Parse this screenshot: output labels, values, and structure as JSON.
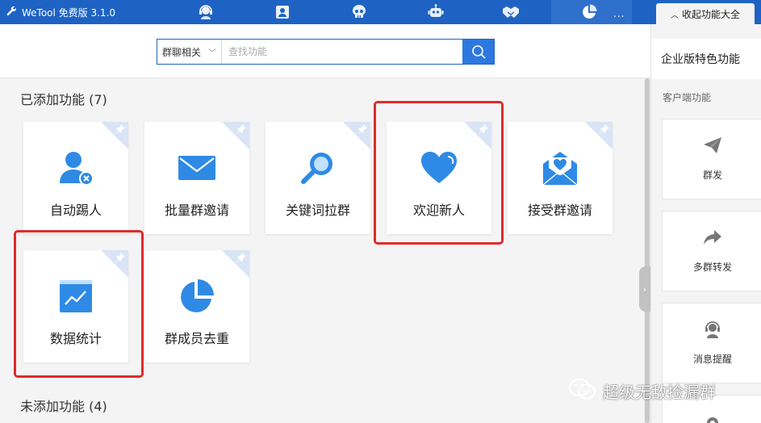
{
  "window": {
    "title": "WeTool 免费版 3.1.0",
    "collapse_label": "收起功能大全",
    "more": "..."
  },
  "nav_icons": [
    "customer-service-icon",
    "contact-card-icon",
    "skull-icon",
    "robot-icon",
    "handshake-icon",
    "pie-chart-icon"
  ],
  "search": {
    "category": "群聊相关",
    "placeholder": "查找功能"
  },
  "added": {
    "title": "已添加功能 (7)",
    "items": [
      {
        "label": "自动踢人",
        "icon": "user-remove-icon"
      },
      {
        "label": "批量群邀请",
        "icon": "envelope-icon"
      },
      {
        "label": "关键词拉群",
        "icon": "magnifier-icon"
      },
      {
        "label": "欢迎新人",
        "icon": "heart-icon"
      },
      {
        "label": "接受群邀请",
        "icon": "envelope-heart-icon"
      },
      {
        "label": "数据统计",
        "icon": "line-chart-icon"
      },
      {
        "label": "群成员去重",
        "icon": "pie-chart-icon"
      }
    ]
  },
  "not_added": {
    "title": "未添加功能 (4)"
  },
  "right_panel": {
    "title": "企业版特色功能",
    "subtitle": "客户端功能",
    "items": [
      {
        "label": "群发",
        "icon": "paper-plane-icon"
      },
      {
        "label": "多群转发",
        "icon": "forward-arrow-icon"
      },
      {
        "label": "消息提醒",
        "icon": "headset-icon"
      }
    ]
  },
  "watermark": "超级无敌捡漏群",
  "colors": {
    "titlebar": "#1e63c4",
    "accent": "#2c78e0",
    "highlight": "#e02b2b"
  }
}
